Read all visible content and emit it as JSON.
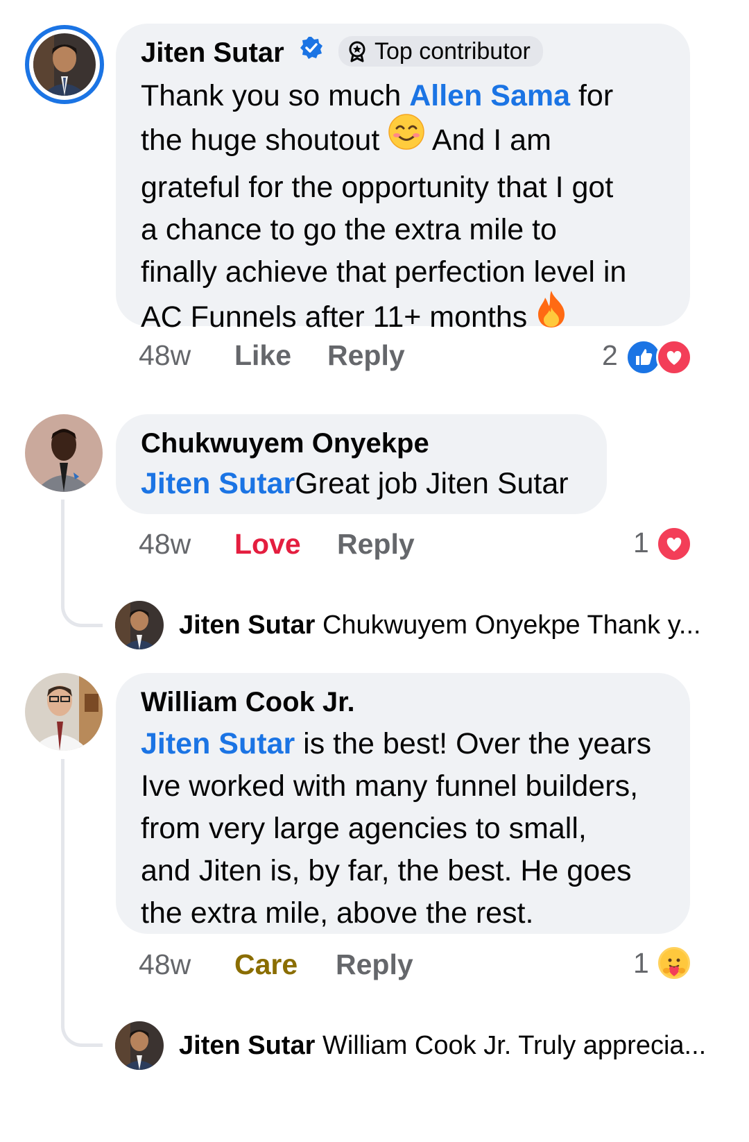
{
  "comments": [
    {
      "author": "Jiten Sutar",
      "badge": "Top contributor",
      "mention": "Allen Sama",
      "lines": {
        "l1a": "Thank you so much ",
        "l1b": " for",
        "l2a": "the huge shoutout ",
        "l2b": " And I am",
        "l3": "grateful for the opportunity that I got",
        "l4": "a chance to go the extra mile to",
        "l5": "finally achieve that perfection level in",
        "l6": "AC Funnels after 11+ months "
      },
      "time": "48w",
      "action1": "Like",
      "reply": "Reply",
      "reaction_count": "2"
    },
    {
      "author": "Chukwuyem Onyekpe",
      "mention": "Jiten Sutar",
      "text": "Great job Jiten Sutar",
      "time": "48w",
      "action1": "Love",
      "reply": "Reply",
      "reaction_count": "1"
    },
    {
      "author": "William Cook Jr.",
      "mention": "Jiten Sutar",
      "lines": {
        "l1": " is the best! Over the years",
        "l2": "Ive worked with many funnel builders,",
        "l3": "from very large agencies to small,",
        "l4": "and Jiten is, by far, the best. He goes",
        "l5": "the extra mile, above the rest."
      },
      "time": "48w",
      "action1": "Care",
      "reply": "Reply",
      "reaction_count": "1"
    }
  ],
  "replies": [
    {
      "author": "Jiten Sutar",
      "preview": "Chukwuyem Onyekpe Thank y..."
    },
    {
      "author": "Jiten Sutar",
      "preview": "William Cook Jr. Truly apprecia..."
    }
  ],
  "colors": {
    "link": "#1b74e4",
    "love": "#e41e3f",
    "care": "#8a6d00",
    "bubble": "#f0f2f5",
    "muted": "#65676b"
  },
  "icons": [
    "verified-badge-icon",
    "top-contributor-icon",
    "smiling-emoji-icon",
    "fire-emoji-icon",
    "like-reaction-icon",
    "love-reaction-icon",
    "care-reaction-icon"
  ]
}
